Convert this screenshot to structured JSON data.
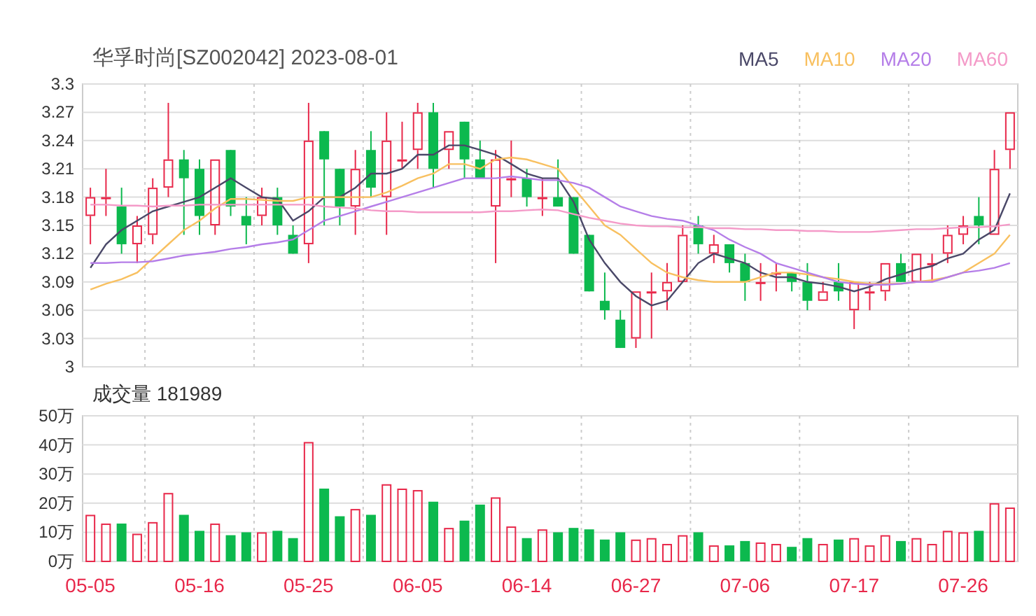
{
  "header": {
    "title": "华孚时尚[SZ002042] 2023-08-01"
  },
  "price_chart": {
    "chart_data": {
      "type": "candlestick",
      "grid": true,
      "ylim": [
        3,
        3.3
      ],
      "yticks": [
        3,
        3.03,
        3.06,
        3.09,
        3.12,
        3.15,
        3.18,
        3.21,
        3.24,
        3.27,
        3.3
      ],
      "series": [
        {
          "name": "MA5",
          "type": "line",
          "color": "#4a4868",
          "values": [
            3.105,
            3.13,
            3.145,
            3.155,
            3.165,
            3.17,
            3.175,
            3.18,
            3.19,
            3.2,
            3.19,
            3.18,
            3.178,
            3.155,
            3.165,
            3.18,
            3.18,
            3.19,
            3.205,
            3.205,
            3.21,
            3.225,
            3.225,
            3.235,
            3.235,
            3.23,
            3.225,
            3.215,
            3.205,
            3.2,
            3.2,
            3.175,
            3.135,
            3.11,
            3.09,
            3.075,
            3.065,
            3.07,
            3.09,
            3.11,
            3.12,
            3.115,
            3.11,
            3.1,
            3.095,
            3.095,
            3.09,
            3.088,
            3.085,
            3.08,
            3.085,
            3.093,
            3.098,
            3.103,
            3.107,
            3.115,
            3.12,
            3.135,
            3.145,
            3.184
          ]
        },
        {
          "name": "MA10",
          "type": "line",
          "color": "#f8c060",
          "values": [
            3.082,
            3.088,
            3.093,
            3.1,
            3.115,
            3.13,
            3.145,
            3.155,
            3.168,
            3.178,
            3.178,
            3.177,
            3.176,
            3.176,
            3.18,
            3.18,
            3.18,
            3.18,
            3.18,
            3.185,
            3.192,
            3.2,
            3.205,
            3.215,
            3.215,
            3.21,
            3.22,
            3.222,
            3.22,
            3.215,
            3.21,
            3.19,
            3.17,
            3.15,
            3.14,
            3.125,
            3.11,
            3.1,
            3.095,
            3.092,
            3.09,
            3.09,
            3.09,
            3.095,
            3.1,
            3.1,
            3.098,
            3.095,
            3.093,
            3.09,
            3.088,
            3.088,
            3.088,
            3.09,
            3.092,
            3.095,
            3.1,
            3.11,
            3.12,
            3.14
          ]
        },
        {
          "name": "MA20",
          "type": "line",
          "color": "#b57ee8",
          "values": [
            3.11,
            3.11,
            3.111,
            3.111,
            3.112,
            3.115,
            3.118,
            3.12,
            3.122,
            3.125,
            3.127,
            3.13,
            3.132,
            3.135,
            3.145,
            3.155,
            3.16,
            3.165,
            3.17,
            3.175,
            3.18,
            3.185,
            3.19,
            3.195,
            3.2,
            3.2,
            3.2,
            3.202,
            3.2,
            3.198,
            3.198,
            3.195,
            3.19,
            3.18,
            3.17,
            3.165,
            3.16,
            3.157,
            3.155,
            3.15,
            3.145,
            3.135,
            3.127,
            3.12,
            3.11,
            3.105,
            3.1,
            3.095,
            3.09,
            3.088,
            3.087,
            3.087,
            3.088,
            3.09,
            3.09,
            3.095,
            3.1,
            3.102,
            3.105,
            3.11
          ]
        },
        {
          "name": "MA60",
          "type": "line",
          "color": "#f49ac8",
          "values": [
            3.172,
            3.172,
            3.171,
            3.171,
            3.17,
            3.171,
            3.171,
            3.172,
            3.172,
            3.172,
            3.172,
            3.172,
            3.172,
            3.172,
            3.172,
            3.17,
            3.169,
            3.168,
            3.166,
            3.165,
            3.165,
            3.164,
            3.164,
            3.164,
            3.164,
            3.164,
            3.165,
            3.165,
            3.166,
            3.167,
            3.166,
            3.162,
            3.158,
            3.155,
            3.152,
            3.15,
            3.149,
            3.149,
            3.148,
            3.148,
            3.147,
            3.147,
            3.146,
            3.146,
            3.145,
            3.145,
            3.144,
            3.144,
            3.143,
            3.143,
            3.143,
            3.144,
            3.145,
            3.146,
            3.146,
            3.147,
            3.148,
            3.148,
            3.149,
            3.151
          ]
        }
      ],
      "ohlc": [
        [
          3.16,
          3.19,
          3.13,
          3.18
        ],
        [
          3.18,
          3.21,
          3.16,
          3.18
        ],
        [
          3.17,
          3.19,
          3.12,
          3.13
        ],
        [
          3.13,
          3.16,
          3.11,
          3.15
        ],
        [
          3.14,
          3.2,
          3.13,
          3.19
        ],
        [
          3.19,
          3.28,
          3.18,
          3.22
        ],
        [
          3.22,
          3.23,
          3.14,
          3.2
        ],
        [
          3.21,
          3.22,
          3.14,
          3.16
        ],
        [
          3.15,
          3.22,
          3.14,
          3.22
        ],
        [
          3.23,
          3.23,
          3.16,
          3.17
        ],
        [
          3.16,
          3.18,
          3.13,
          3.15
        ],
        [
          3.16,
          3.19,
          3.15,
          3.18
        ],
        [
          3.18,
          3.19,
          3.14,
          3.15
        ],
        [
          3.14,
          3.15,
          3.12,
          3.12
        ],
        [
          3.13,
          3.28,
          3.11,
          3.24
        ],
        [
          3.25,
          3.25,
          3.15,
          3.22
        ],
        [
          3.21,
          3.21,
          3.15,
          3.17
        ],
        [
          3.17,
          3.23,
          3.14,
          3.21
        ],
        [
          3.23,
          3.25,
          3.18,
          3.19
        ],
        [
          3.18,
          3.27,
          3.14,
          3.24
        ],
        [
          3.22,
          3.26,
          3.21,
          3.22
        ],
        [
          3.23,
          3.28,
          3.21,
          3.27
        ],
        [
          3.27,
          3.28,
          3.19,
          3.21
        ],
        [
          3.23,
          3.25,
          3.21,
          3.25
        ],
        [
          3.26,
          3.26,
          3.2,
          3.22
        ],
        [
          3.22,
          3.24,
          3.2,
          3.2
        ],
        [
          3.17,
          3.23,
          3.11,
          3.22
        ],
        [
          3.2,
          3.24,
          3.18,
          3.2
        ],
        [
          3.2,
          3.21,
          3.17,
          3.18
        ],
        [
          3.18,
          3.2,
          3.16,
          3.18
        ],
        [
          3.18,
          3.22,
          3.17,
          3.17
        ],
        [
          3.18,
          3.18,
          3.12,
          3.12
        ],
        [
          3.14,
          3.14,
          3.08,
          3.08
        ],
        [
          3.07,
          3.1,
          3.05,
          3.06
        ],
        [
          3.05,
          3.06,
          3.02,
          3.02
        ],
        [
          3.03,
          3.08,
          3.02,
          3.08
        ],
        [
          3.08,
          3.1,
          3.03,
          3.08
        ],
        [
          3.08,
          3.11,
          3.06,
          3.09
        ],
        [
          3.09,
          3.15,
          3.09,
          3.14
        ],
        [
          3.15,
          3.16,
          3.12,
          3.13
        ],
        [
          3.12,
          3.14,
          3.11,
          3.13
        ],
        [
          3.13,
          3.13,
          3.1,
          3.11
        ],
        [
          3.11,
          3.12,
          3.07,
          3.09
        ],
        [
          3.09,
          3.11,
          3.07,
          3.09
        ],
        [
          3.1,
          3.11,
          3.08,
          3.1
        ],
        [
          3.1,
          3.1,
          3.08,
          3.09
        ],
        [
          3.09,
          3.11,
          3.06,
          3.07
        ],
        [
          3.07,
          3.09,
          3.07,
          3.08
        ],
        [
          3.09,
          3.11,
          3.07,
          3.08
        ],
        [
          3.06,
          3.09,
          3.04,
          3.09
        ],
        [
          3.08,
          3.09,
          3.06,
          3.08
        ],
        [
          3.08,
          3.11,
          3.07,
          3.11
        ],
        [
          3.11,
          3.12,
          3.09,
          3.09
        ],
        [
          3.09,
          3.12,
          3.09,
          3.12
        ],
        [
          3.11,
          3.12,
          3.09,
          3.11
        ],
        [
          3.12,
          3.15,
          3.11,
          3.14
        ],
        [
          3.14,
          3.16,
          3.13,
          3.15
        ],
        [
          3.16,
          3.18,
          3.13,
          3.15
        ],
        [
          3.14,
          3.23,
          3.14,
          3.21
        ],
        [
          3.23,
          3.27,
          3.21,
          3.27
        ]
      ]
    }
  },
  "volume_chart": {
    "title": "成交量 181989",
    "chart_data": {
      "type": "bar",
      "grid": true,
      "ylim": [
        0,
        50
      ],
      "yticks": [
        {
          "value": 0,
          "label": "0万"
        },
        {
          "value": 10,
          "label": "10万"
        },
        {
          "value": 20,
          "label": "20万"
        },
        {
          "value": 30,
          "label": "30万"
        },
        {
          "value": 40,
          "label": "40万"
        },
        {
          "value": 50,
          "label": "50万"
        }
      ],
      "categories": [
        "05-05",
        null,
        null,
        null,
        null,
        null,
        null,
        "05-16",
        null,
        null,
        null,
        null,
        null,
        null,
        "05-25",
        null,
        null,
        null,
        null,
        null,
        null,
        "06-05",
        null,
        null,
        null,
        null,
        null,
        null,
        "06-14",
        null,
        null,
        null,
        null,
        null,
        null,
        "06-27",
        null,
        null,
        null,
        null,
        null,
        null,
        "07-06",
        null,
        null,
        null,
        null,
        null,
        null,
        "07-17",
        null,
        null,
        null,
        null,
        null,
        null,
        "07-26",
        null,
        null,
        null
      ],
      "values": [
        16,
        13,
        13,
        9.5,
        13.5,
        23.5,
        16,
        10.5,
        13,
        9,
        10,
        10,
        10.5,
        8,
        41,
        25,
        15.5,
        18,
        16,
        26.5,
        25,
        24.5,
        20.5,
        11.5,
        14,
        19.5,
        22,
        12,
        8,
        11,
        10,
        11.5,
        11,
        7.5,
        10,
        7.5,
        8,
        6,
        9,
        10,
        5.5,
        5.5,
        7,
        6.5,
        6,
        5,
        8,
        6,
        7.5,
        8,
        5.5,
        9,
        7,
        8,
        6,
        10.5,
        10,
        10.5,
        20,
        18.5
      ]
    }
  }
}
